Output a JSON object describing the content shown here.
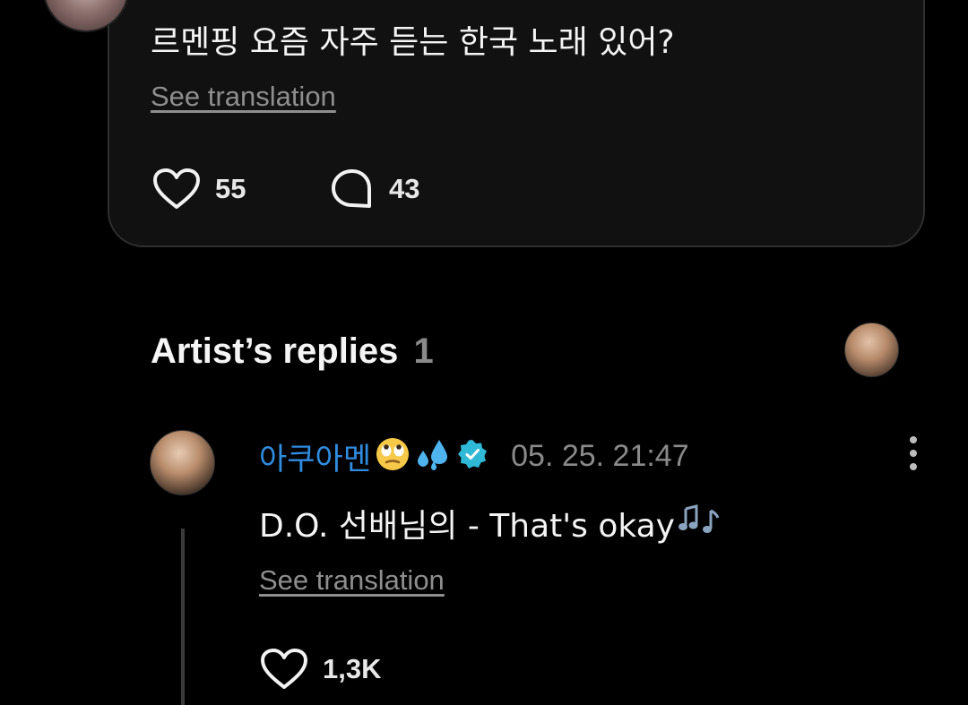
{
  "post": {
    "text": "르멘핑 요즘 자주 듣는 한국 노래 있어?",
    "see_translation": "See translation",
    "likes": "55",
    "comments": "43"
  },
  "artist_replies": {
    "title": "Artist’s replies",
    "count": "1"
  },
  "reply": {
    "username": "아쿠아멘",
    "timestamp": "05. 25. 21:47",
    "text": "D.O. 선배님의 - That's okay",
    "see_translation": "See translation",
    "likes": "1,3K"
  },
  "icons": {
    "like": "heart-outline-icon",
    "comment": "speech-bubble-icon",
    "verified": "verified-badge-icon",
    "more": "more-vertical-icon",
    "emoji_face": "rolling-eyes-emoji",
    "emoji_drops": "sweat-droplets-emoji",
    "emoji_notes": "music-notes-emoji"
  },
  "colors": {
    "background": "#000000",
    "card": "#111111",
    "username": "#2f8ce0",
    "muted": "#8a8a8a",
    "verified": "#2fb9d6"
  }
}
